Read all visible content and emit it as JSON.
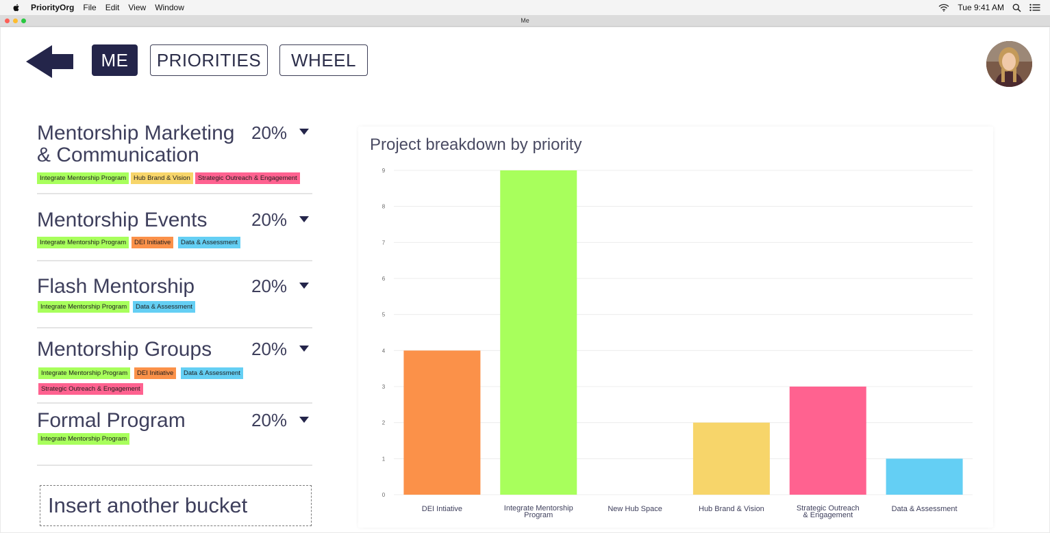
{
  "menubar": {
    "app_name": "PriorityOrg",
    "menus": [
      "File",
      "Edit",
      "View",
      "Window"
    ],
    "clock": "Tue 9:41 AM"
  },
  "window": {
    "title": "Me"
  },
  "nav": {
    "me": "ME",
    "priorities": "PRIORITIES",
    "wheel": "WHEEL"
  },
  "buckets": [
    {
      "title_line1": "Mentorship Marketing",
      "title_line2": "& Communication",
      "percent": "20%",
      "tags": [
        "Integrate Mentorship Program",
        "Hub Brand & Vision",
        "Strategic Outreach & Engagement"
      ]
    },
    {
      "title": "Mentorship Events",
      "percent": "20%",
      "tags": [
        "Integrate Mentorship Program",
        "DEI Initiative",
        "Data & Assessment"
      ]
    },
    {
      "title": "Flash Mentorship",
      "percent": "20%",
      "tags": [
        "Integrate Mentorship Program",
        "Data & Assessment"
      ]
    },
    {
      "title": "Mentorship Groups",
      "percent": "20%",
      "tags": [
        "Integrate Mentorship Program",
        "DEI Initiative",
        "Data & Assessment",
        "Strategic Outreach & Engagement"
      ]
    },
    {
      "title": "Formal Program",
      "percent": "20%",
      "tags": [
        "Integrate Mentorship Program"
      ]
    }
  ],
  "insert_bucket": "Insert another bucket",
  "colors": {
    "navy": "#24254a",
    "green": "#a8ff5c",
    "orange": "#fb9149",
    "yellow": "#f7d56a",
    "pink": "#ff6290",
    "blue": "#64cff4"
  },
  "chart_data": {
    "type": "bar",
    "title": "Project breakdown by priority",
    "categories": [
      "DEI Intiative",
      "Integrate Mentorship Program",
      "New Hub Space",
      "Hub Brand & Vision",
      "Strategic Outreach & Engagement",
      "Data & Assessment"
    ],
    "category_lines": [
      [
        "DEI Intiative"
      ],
      [
        "Integrate Mentorship",
        "Program"
      ],
      [
        "New Hub Space"
      ],
      [
        "Hub Brand & Vision"
      ],
      [
        "Strategic Outreach",
        "& Engagement"
      ],
      [
        "Data & Assessment"
      ]
    ],
    "values": [
      4,
      9,
      0,
      2,
      3,
      1
    ],
    "bar_colors": [
      "#fb9149",
      "#a8ff5c",
      "#cccccc",
      "#f7d56a",
      "#ff6290",
      "#64cff4"
    ],
    "ylim": [
      0,
      9
    ],
    "yticks": [
      "0",
      "1",
      "2",
      "3",
      "4",
      "5",
      "6",
      "7",
      "8",
      "9"
    ],
    "grid": true
  }
}
